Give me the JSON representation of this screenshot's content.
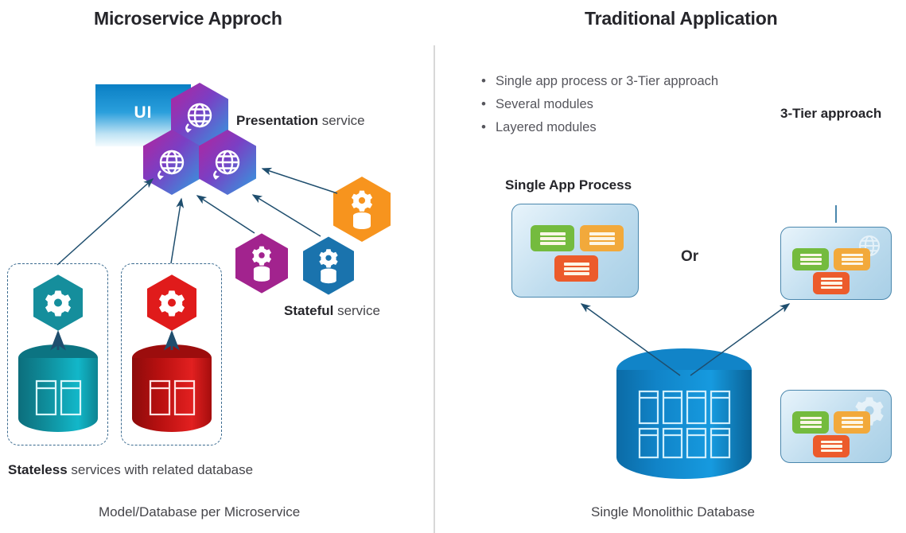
{
  "left_panel": {
    "title": "Microservice Approch",
    "ui_box_label": "UI",
    "presentation_label_bold": "Presentation",
    "presentation_label_rest": " service",
    "stateful_label_bold": "Stateful",
    "stateful_label_rest": " service",
    "stateless_caption_bold": "Stateless",
    "stateless_caption_rest": " services with related database",
    "bottom_caption": "Model/Database per Microservice",
    "stateful_services": [
      {
        "name": "orange-stateful-service",
        "color": "#f7941e",
        "icon": "gear-database-icon"
      },
      {
        "name": "purple-stateful-service",
        "color": "#a2238e",
        "icon": "gear-database-icon"
      },
      {
        "name": "blue-stateful-service",
        "color": "#1a73ad",
        "icon": "gear-database-icon"
      }
    ],
    "presentation_services": [
      {
        "name": "presentation-hex-top",
        "icon": "globe-icon"
      },
      {
        "name": "presentation-hex-left",
        "icon": "globe-icon"
      },
      {
        "name": "presentation-hex-right",
        "icon": "globe-icon"
      }
    ],
    "stateless_services": [
      {
        "name": "teal-stateless-service",
        "hex_color": "#158e9c",
        "db_color": "#0f8d9b",
        "icon": "gear-icon",
        "db_icon": "database-icon",
        "tables": 2
      },
      {
        "name": "red-stateless-service",
        "hex_color": "#e01b1b",
        "db_color": "#b81010",
        "icon": "gear-icon",
        "db_icon": "database-icon",
        "tables": 2
      }
    ]
  },
  "right_panel": {
    "title": "Traditional Application",
    "bullets": [
      "Single app process or 3-Tier approach",
      "Several modules",
      "Layered modules"
    ],
    "single_app_title": "Single App Process",
    "three_tier_title": "3-Tier approach",
    "or_label": "Or",
    "bottom_caption": "Single Monolithic Database",
    "modules": [
      {
        "name": "green-module",
        "color": "#74bb3e"
      },
      {
        "name": "orange-module",
        "color": "#f2a93b"
      },
      {
        "name": "red-module",
        "color": "#ec5b2b"
      }
    ],
    "tier_boxes": [
      {
        "name": "presentation-tier-box",
        "icon": "globe-icon"
      },
      {
        "name": "logic-tier-box",
        "icon": "gear-icon"
      }
    ],
    "monolithic_db": {
      "name": "monolithic-database",
      "color": "#1184c8",
      "tables": 8
    }
  },
  "colors": {
    "accent_blue": "#1184c8",
    "arrow": "#1f4e6e",
    "divider": "#d8d8d8",
    "text_dark": "#25252a",
    "text_muted": "#55555c"
  }
}
